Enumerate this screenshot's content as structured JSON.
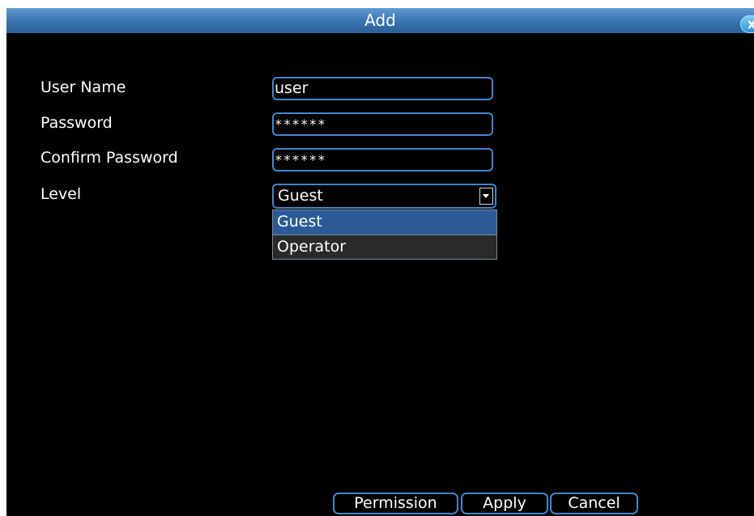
{
  "window": {
    "title": "Add",
    "close_icon": "close-icon",
    "close_glyph": "x"
  },
  "form": {
    "username_label": "User Name",
    "username_value": "user",
    "password_label": "Password",
    "password_value": "******",
    "confirm_label": "Confirm Password",
    "confirm_value": "******",
    "level_label": "Level",
    "level_value": "Guest",
    "level_options": [
      "Guest",
      "Operator"
    ]
  },
  "buttons": {
    "permission": "Permission",
    "apply": "Apply",
    "cancel": "Cancel"
  },
  "colors": {
    "accent": "#3f87d0",
    "title_bar": "#3d78b3",
    "selected_option": "#2b5a97",
    "background": "#000000"
  }
}
